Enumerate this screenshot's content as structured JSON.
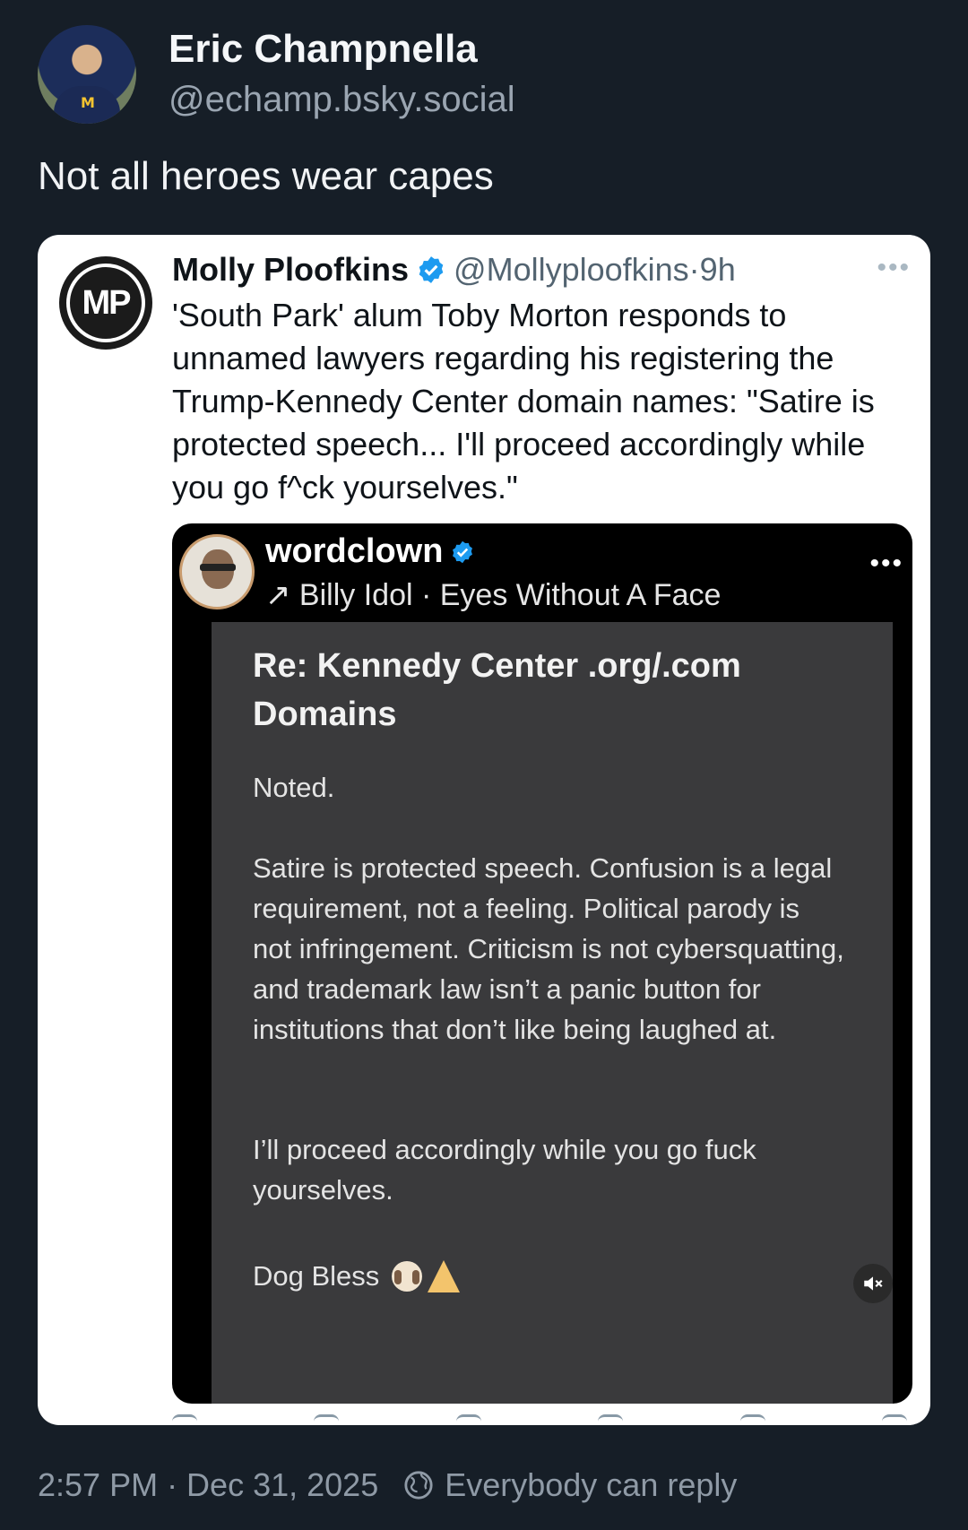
{
  "post": {
    "author": {
      "display_name": "Eric Champnella",
      "handle": "@echamp.bsky.social"
    },
    "text": "Not all heroes wear capes",
    "timestamp": "2:57 PM · Dec 31, 2025",
    "reply_setting": "Everybody can reply"
  },
  "quoted": {
    "author": {
      "display_name": "Molly Ploofkins",
      "handle": "@Mollyploofkins",
      "avatar_text": "MP"
    },
    "separator": "·",
    "time": "9h",
    "more": "•••",
    "text": "'South Park' alum Toby Morton responds to unnamed lawyers regarding his registering the Trump-Kennedy Center domain names: \"Satire is protected speech... I'll proceed accordingly while you go f^ck yourselves.\""
  },
  "embedded_screenshot": {
    "username": "wordclown",
    "song": "↗ Billy Idol · Eyes Without A Face",
    "more": "•••",
    "title": "Re: Kennedy Center .org/.com Domains",
    "paragraph1": "Noted.",
    "paragraph2": "Satire is protected speech. Confusion is a legal requirement, not a feeling. Political parody is not infringement. Criticism is not cybersquatting, and trademark law isn’t a panic button for institutions that don’t like being laughed at.",
    "paragraph3": "I’ll proceed accordingly while you go fuck yourselves.",
    "sign_off": "Dog Bless"
  },
  "colors": {
    "background": "#161e27",
    "verified_blue": "#1d9bf0",
    "muted_text": "#8f9aa6"
  },
  "icons": [
    "verified-badge-icon",
    "more-options-icon",
    "music-arrow-icon",
    "dog-emoji-icon",
    "praying-hands-emoji-icon",
    "mute-icon",
    "globe-icon"
  ]
}
